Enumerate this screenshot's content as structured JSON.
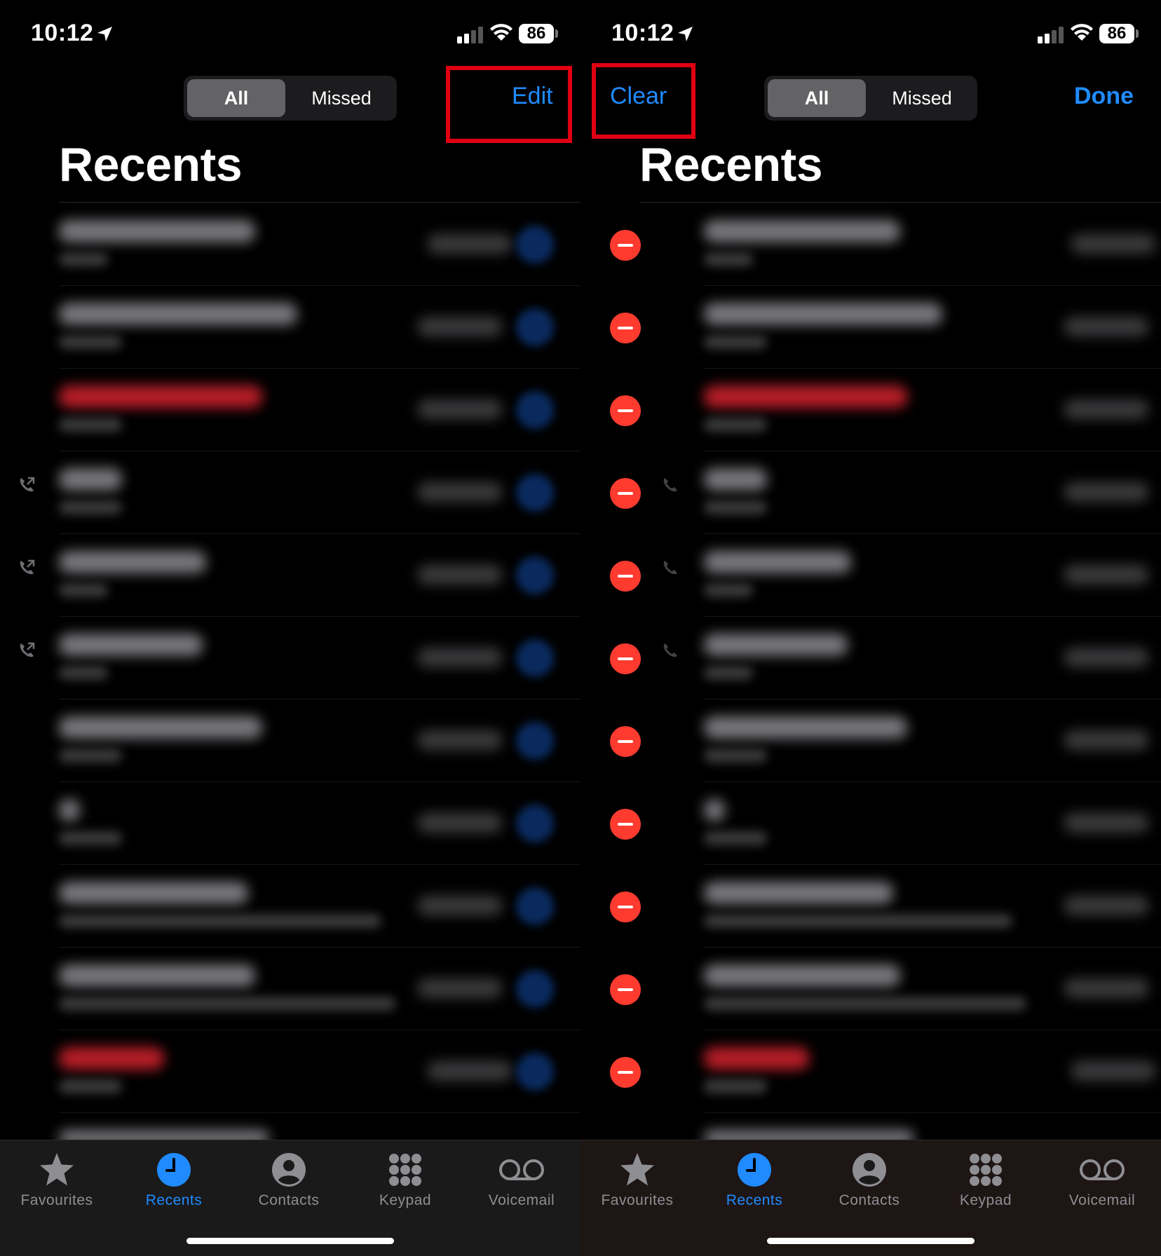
{
  "status_bar": {
    "time": "10:12",
    "battery": "86"
  },
  "segments": {
    "all": "All",
    "missed": "Missed"
  },
  "left_panel": {
    "edit_label": "Edit",
    "title": "Recents"
  },
  "right_panel": {
    "clear_label": "Clear",
    "done_label": "Done",
    "title": "Recents"
  },
  "tabs": [
    {
      "label": "Favourites",
      "icon": "star-icon"
    },
    {
      "label": "Recents",
      "icon": "clock-icon",
      "active": true
    },
    {
      "label": "Contacts",
      "icon": "person-icon"
    },
    {
      "label": "Keypad",
      "icon": "keypad-icon"
    },
    {
      "label": "Voicemail",
      "icon": "voicemail-icon"
    }
  ],
  "colors": {
    "accent": "#1f8bff",
    "highlight_box": "#e00012",
    "delete": "#ff3b30"
  }
}
